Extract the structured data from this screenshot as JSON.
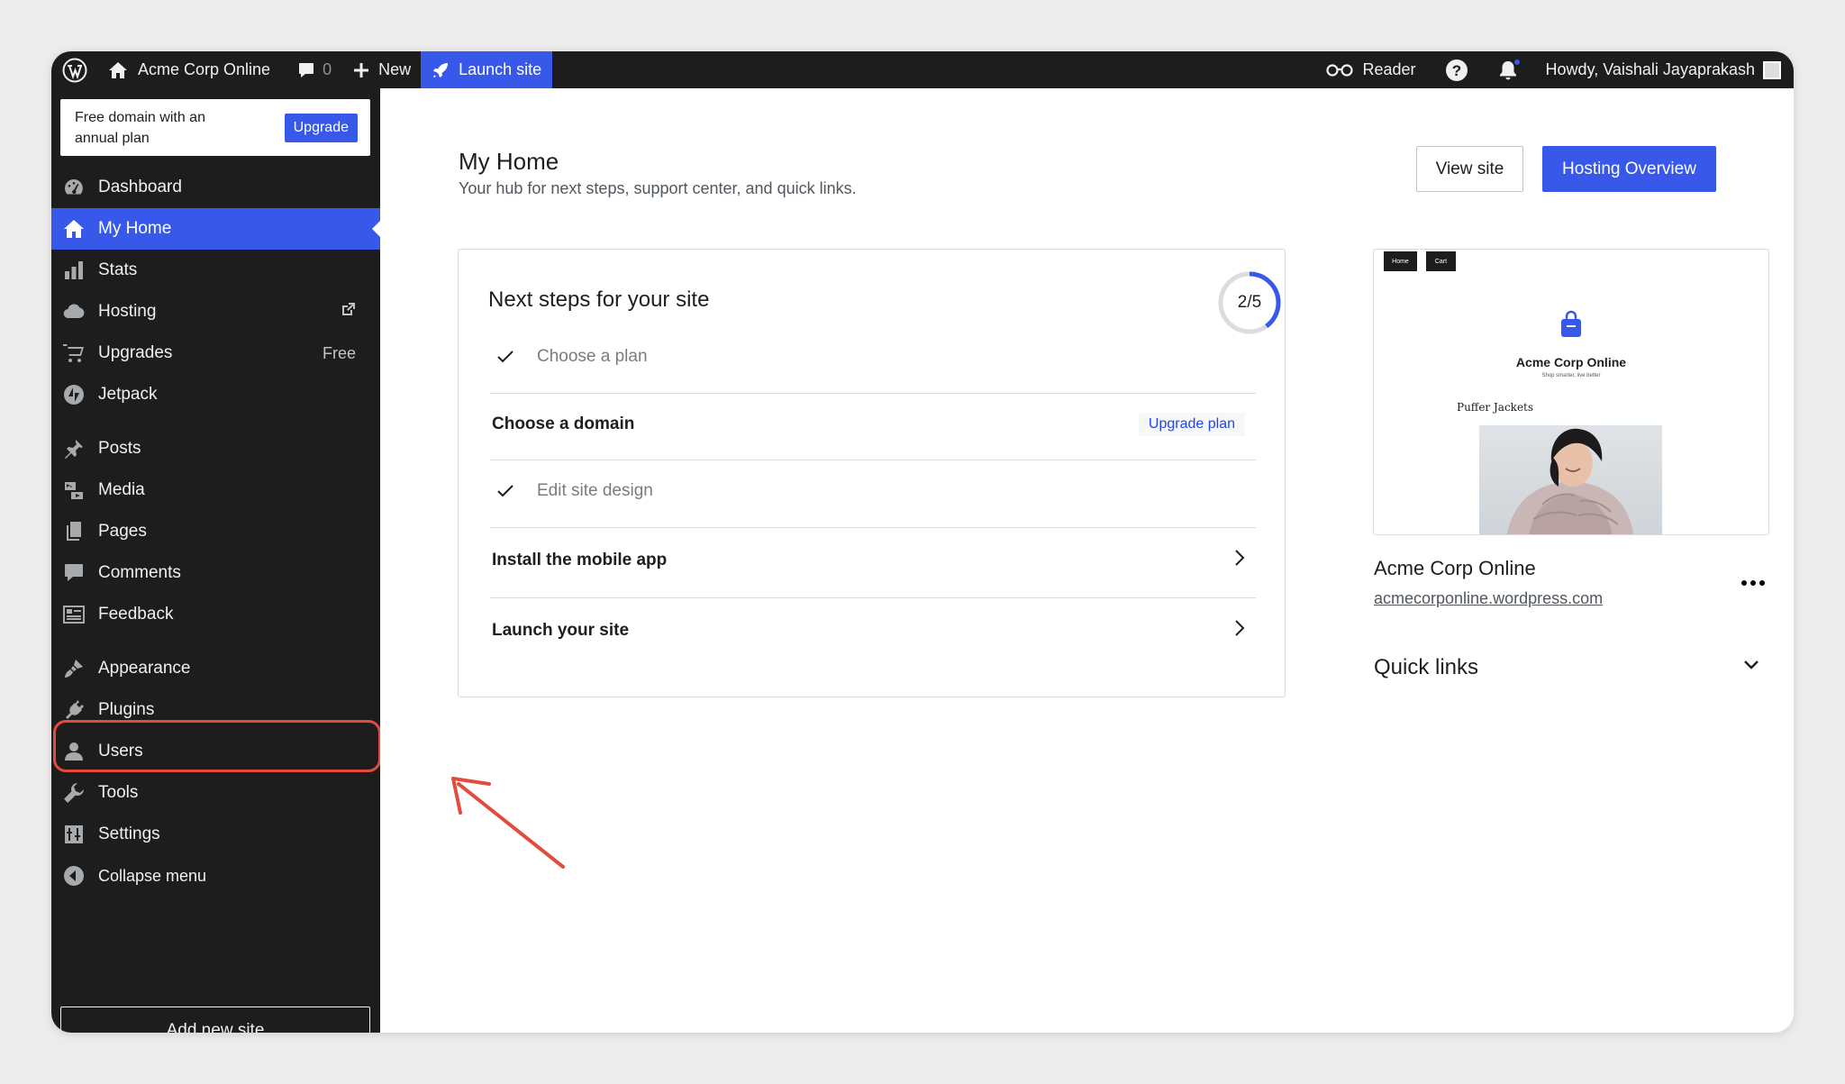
{
  "adminbar": {
    "site_name": "Acme Corp Online",
    "comments_count": "0",
    "new_label": "New",
    "launch_label": "Launch site",
    "reader_label": "Reader",
    "howdy": "Howdy, Vaishali Jayaprakash"
  },
  "promo": {
    "text": "Free domain with an annual plan",
    "button": "Upgrade"
  },
  "sidebar": {
    "items": [
      {
        "label": "Dashboard",
        "icon": "dashboard-icon"
      },
      {
        "label": "My Home",
        "icon": "home-icon",
        "active": true
      },
      {
        "label": "Stats",
        "icon": "stats-icon"
      },
      {
        "label": "Hosting",
        "icon": "cloud-icon",
        "external": true
      },
      {
        "label": "Upgrades",
        "icon": "cart-icon",
        "badge": "Free"
      },
      {
        "label": "Jetpack",
        "icon": "jetpack-icon"
      },
      {
        "label": "Posts",
        "icon": "pin-icon"
      },
      {
        "label": "Media",
        "icon": "media-icon"
      },
      {
        "label": "Pages",
        "icon": "pages-icon"
      },
      {
        "label": "Comments",
        "icon": "comment-icon"
      },
      {
        "label": "Feedback",
        "icon": "feedback-icon"
      },
      {
        "label": "Appearance",
        "icon": "brush-icon"
      },
      {
        "label": "Plugins",
        "icon": "plugin-icon"
      },
      {
        "label": "Users",
        "icon": "user-icon"
      },
      {
        "label": "Tools",
        "icon": "wrench-icon"
      },
      {
        "label": "Settings",
        "icon": "settings-icon"
      },
      {
        "label": "Collapse menu",
        "icon": "collapse-icon"
      }
    ],
    "add_site": "Add new site"
  },
  "main": {
    "title": "My Home",
    "subtitle": "Your hub for next steps, support center, and quick links.",
    "view_site": "View site",
    "hosting_overview": "Hosting Overview"
  },
  "next_steps": {
    "title": "Next steps for your site",
    "progress_text": "2/5",
    "progress_fraction": 0.4,
    "tasks": [
      {
        "label": "Choose a plan",
        "done": true
      },
      {
        "label": "Choose a domain",
        "done": false,
        "action": "Upgrade plan"
      },
      {
        "label": "Edit site design",
        "done": true
      },
      {
        "label": "Install the mobile app",
        "done": false
      },
      {
        "label": "Launch your site",
        "done": false
      }
    ]
  },
  "preview": {
    "nav": [
      "Home",
      "Cart"
    ],
    "site_title": "Acme Corp Online",
    "tagline": "Shop smarter, live better",
    "heading": "Puffer Jackets"
  },
  "site": {
    "name": "Acme Corp Online",
    "url": "acmecorponline.wordpress.com"
  },
  "quick_links": {
    "title": "Quick links"
  },
  "colors": {
    "accent": "#3858e9",
    "admin_bg": "#1d1d1d",
    "highlight": "#e34b3f"
  }
}
